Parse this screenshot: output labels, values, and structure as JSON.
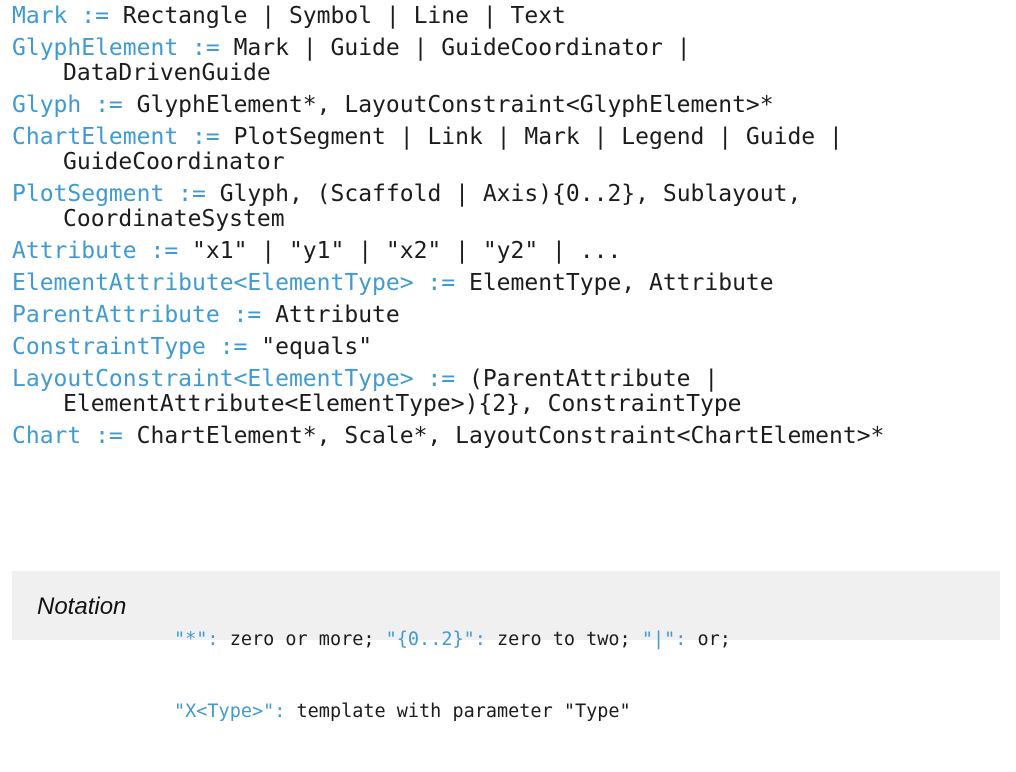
{
  "grammar": {
    "rules": [
      {
        "lhs": "Mark :=",
        "rhs": [
          "Rectangle | Symbol | Line | Text"
        ]
      },
      {
        "lhs": "GlyphElement :=",
        "rhs": [
          "Mark | Guide | GuideCoordinator |",
          "DataDrivenGuide"
        ]
      },
      {
        "lhs": "Glyph :=",
        "rhs": [
          "GlyphElement*, LayoutConstraint<GlyphElement>*"
        ]
      },
      {
        "lhs": "ChartElement :=",
        "rhs": [
          "PlotSegment | Link | Mark | Legend | Guide |",
          "GuideCoordinator"
        ]
      },
      {
        "lhs": "PlotSegment :=",
        "rhs": [
          "Glyph, (Scaffold | Axis){0..2}, Sublayout,",
          "CoordinateSystem"
        ]
      },
      {
        "lhs": "Attribute :=",
        "rhs": [
          "\"x1\" | \"y1\" | \"x2\" | \"y2\" | ..."
        ]
      },
      {
        "lhs": "ElementAttribute<ElementType> :=",
        "rhs": [
          "ElementType, Attribute"
        ]
      },
      {
        "lhs": "ParentAttribute :=",
        "rhs": [
          "Attribute"
        ]
      },
      {
        "lhs": "ConstraintType :=",
        "rhs": [
          "\"equals\""
        ]
      },
      {
        "lhs": "LayoutConstraint<ElementType> :=",
        "rhs": [
          "(ParentAttribute |",
          "ElementAttribute<ElementType>){2}, ConstraintType"
        ]
      },
      {
        "lhs": "Chart :=",
        "rhs": [
          "ChartElement*, Scale*, LayoutConstraint<ChartElement>*"
        ]
      }
    ]
  },
  "notation": {
    "label": "Notation",
    "line1": [
      {
        "text": "\"*\":",
        "quoted": true
      },
      {
        "text": " zero or more; ",
        "quoted": false
      },
      {
        "text": "\"{0..2}\":",
        "quoted": true
      },
      {
        "text": " zero to two; ",
        "quoted": false
      },
      {
        "text": "\"|\":",
        "quoted": true
      },
      {
        "text": " or;",
        "quoted": false
      }
    ],
    "line2": [
      {
        "text": "\"X<Type>\":",
        "quoted": true
      },
      {
        "text": " template with parameter \"Type\"",
        "quoted": false
      }
    ]
  },
  "colors": {
    "keyword": "#3f9bd1",
    "text": "#1c1c1c",
    "notation_bg": "#f0f0f0"
  }
}
